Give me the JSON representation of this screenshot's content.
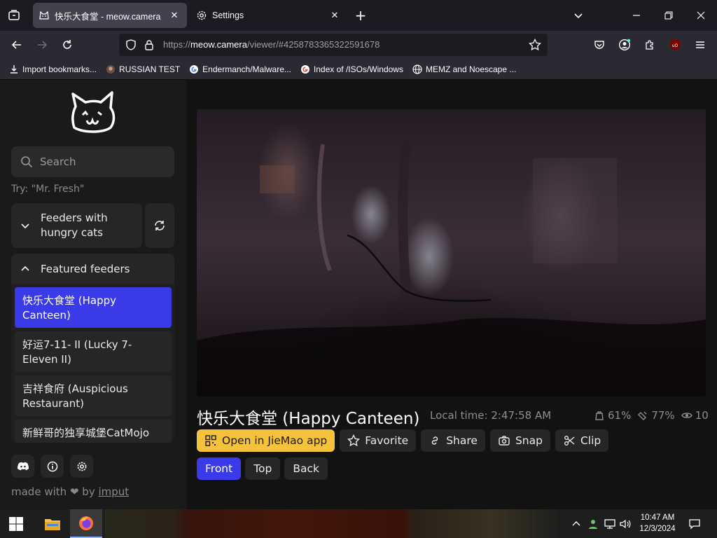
{
  "browser": {
    "tabs": [
      {
        "label": "快乐大食堂 - meow.camera",
        "active": true,
        "icon": "cat-favicon-icon"
      },
      {
        "label": "Settings",
        "active": false,
        "icon": "gear-icon"
      }
    ],
    "url": {
      "scheme": "https://",
      "host": "meow.camera",
      "path": "/viewer/#4258783365322591678"
    },
    "bookmarks": [
      {
        "label": "Import bookmarks...",
        "icon": "import-icon"
      },
      {
        "label": "RUSSIAN TEST",
        "icon": "github-icon"
      },
      {
        "label": "Endermanch/Malware...",
        "icon": "google-icon"
      },
      {
        "label": "Index of /ISOs/Windows",
        "icon": "google-icon"
      },
      {
        "label": "MEMZ and Noescape ...",
        "icon": "globe-icon"
      }
    ]
  },
  "sidebar": {
    "search_placeholder": "Search",
    "try_hint": "Try: \"Mr. Fresh\"",
    "groups": {
      "hungry": "Feeders with hungry cats",
      "featured": "Featured feeders"
    },
    "feeders": [
      {
        "label": "快乐大食堂 (Happy Canteen)",
        "selected": true
      },
      {
        "label": "好运7-11- II  (Lucky 7-Eleven II)",
        "selected": false
      },
      {
        "label": "吉祥食府 (Auspicious Restaurant)",
        "selected": false
      },
      {
        "label": "新鲜哥的独享城堡CatMojo (Mr. Fresh)",
        "selected": false
      }
    ],
    "footer": {
      "made_with": "made with",
      "by": "by",
      "author": "imput"
    }
  },
  "viewer": {
    "title": "快乐大食堂 (Happy Canteen)",
    "local_time_label": "Local time:",
    "local_time": "2:47:58 AM",
    "stats": {
      "food": "61%",
      "water": "77%",
      "viewers": "10"
    },
    "actions": [
      {
        "label": "Open in JieMao app",
        "icon": "qr-code-icon",
        "primary": true
      },
      {
        "label": "Favorite",
        "icon": "star-icon",
        "primary": false
      },
      {
        "label": "Share",
        "icon": "link-icon",
        "primary": false
      },
      {
        "label": "Snap",
        "icon": "camera-icon",
        "primary": false
      },
      {
        "label": "Clip",
        "icon": "scissors-icon",
        "primary": false
      }
    ],
    "camera_views": [
      {
        "label": "Front",
        "active": true
      },
      {
        "label": "Top",
        "active": false
      },
      {
        "label": "Back",
        "active": false
      }
    ]
  },
  "taskbar": {
    "time": "10:47 AM",
    "date": "12/3/2024"
  },
  "colors": {
    "accent": "#3a3ae8",
    "primary_button": "#f5c33b",
    "sidebar_bg": "#1a1a1a",
    "main_bg": "#121212"
  }
}
